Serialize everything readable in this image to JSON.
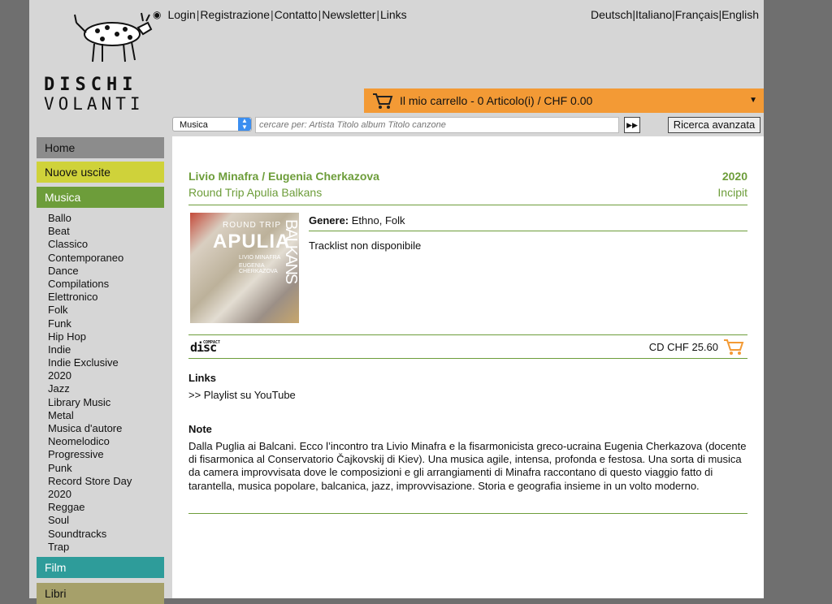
{
  "header": {
    "logo_line1": "DISCHI",
    "logo_line2": "VOLANTI",
    "links": [
      "Login",
      "Registrazione",
      "Contatto",
      "Newsletter",
      "Links"
    ],
    "languages": [
      "Deutsch",
      "Italiano",
      "Français",
      "English"
    ],
    "cart_label": "Il mio carrello - 0 Articolo(i) / CHF 0.00"
  },
  "search": {
    "category": "Musica",
    "placeholder": "cercare per: Artista Titolo album Titolo canzone",
    "advanced_label": "Ricerca avanzata"
  },
  "sidebar": {
    "home": "Home",
    "new": "Nuove uscite",
    "music": "Musica",
    "music_sub": [
      "Ballo",
      "Beat",
      "Classico",
      "Contemporaneo",
      "Dance",
      "Compilations",
      "Elettronico",
      "Folk",
      "Funk",
      "Hip Hop",
      "Indie",
      "Indie Exclusive 2020",
      "Jazz",
      "Library Music",
      "Metal",
      "Musica d'autore",
      "Neomelodico",
      "Progressive",
      "Punk",
      "Record Store Day 2020",
      "Reggae",
      "Soul",
      "Soundtracks",
      "Trap"
    ],
    "film": "Film",
    "books": "Libri"
  },
  "product": {
    "artist": "Livio Minafra / Eugenia Cherkazova",
    "year": "2020",
    "album": "Round Trip Apulia Balkans",
    "label": "Incipit",
    "cover_text": {
      "line1": "ROUND TRIP",
      "line2": "APULIA",
      "line3": "LIVIO MINAFRA",
      "line4": "EUGENIA CHERKAZOVA",
      "side": "BALKANS"
    },
    "genre_label": "Genere:",
    "genre_value": "Ethno, Folk",
    "tracklist": "Tracklist non disponibile",
    "format_logo": "disc",
    "format_logo_small": "COMPACT",
    "price": "CD CHF 25.60",
    "links_title": "Links",
    "youtube_link": ">> Playlist su YouTube",
    "note_title": "Note",
    "note_text": "Dalla Puglia ai Balcani. Ecco l’incontro tra Livio Minafra e la fisarmonicista greco-ucraina Eugenia Cherkazova (docente di fisarmonica al Conservatorio Čajkovskij di Kiev). Una musica agile, intensa, profonda e festosa. Una sorta di musica da camera improvvisata dove le composizioni e gli arrangiamenti di Minafra raccontano di questo viaggio fatto di tarantella, musica popolare, balcanica, jazz, improvvisazione. Storia e geografia insieme in un volto moderno."
  },
  "colors": {
    "accent_green": "#6d9d3a",
    "cart_orange": "#f39a35",
    "header_gray": "#d6d6d6"
  }
}
